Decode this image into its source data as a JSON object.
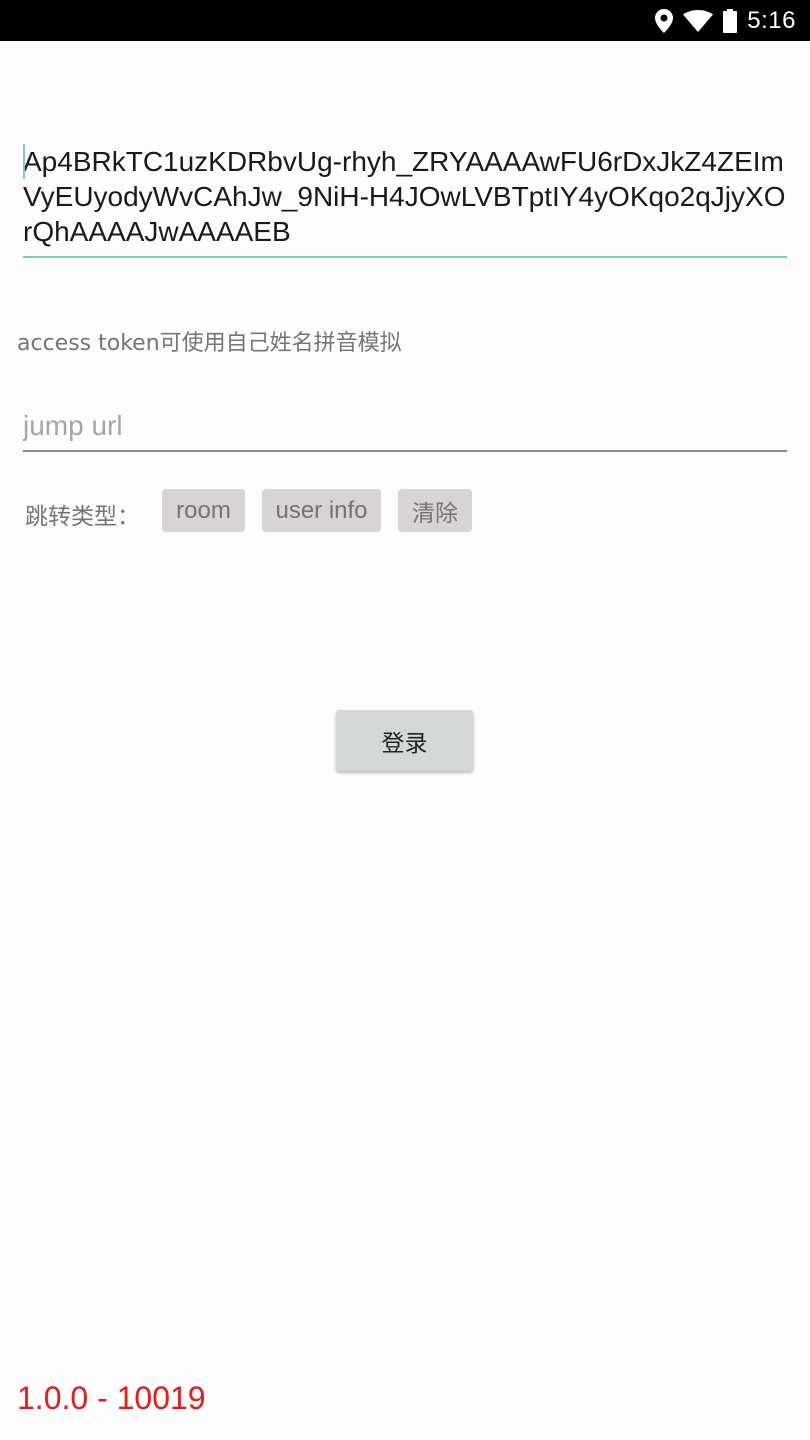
{
  "status_bar": {
    "time": "5:16",
    "icons": [
      "location-icon",
      "wifi-icon",
      "battery-icon"
    ]
  },
  "token_field": {
    "value": "Ap4BRkTC1uzKDRbvUg-rhyh_ZRYAAAAwFU6rDxJkZ4ZEImVyEUyodyWvCAhJw_9NiH-H4JOwLVBTptIY4yOKqo2qJjyXOrQhAAAAJwAAAAEB",
    "underline_color": "#80cbc4"
  },
  "hint": "access token可使用自己姓名拼音模拟",
  "url_field": {
    "placeholder": "jump url",
    "value": ""
  },
  "jump_type": {
    "label": "跳转类型：",
    "options": [
      "room",
      "user info",
      "清除"
    ]
  },
  "login_button": "登录",
  "version": {
    "text": "1.0.0 - 10019",
    "color": "#e81b1b"
  }
}
